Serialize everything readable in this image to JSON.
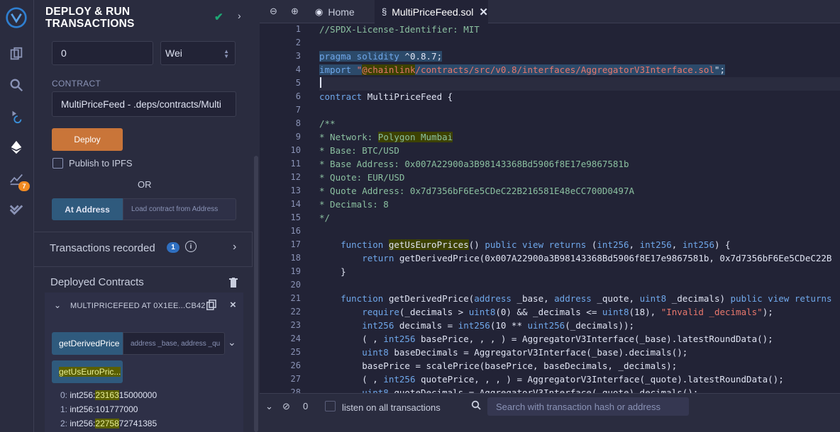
{
  "sidebar": {
    "badge_count": "7"
  },
  "panel": {
    "title": "DEPLOY & RUN TRANSACTIONS",
    "value": "0",
    "unit": "Wei",
    "contract_label": "CONTRACT",
    "contract_selected": "MultiPriceFeed - .deps/contracts/Multi",
    "deploy_label": "Deploy",
    "publish_label": "Publish to IPFS",
    "or_label": "OR",
    "at_address_label": "At Address",
    "at_address_placeholder": "Load contract from Address",
    "transactions_recorded": "Transactions recorded",
    "transactions_count": "1",
    "deployed_contracts": "Deployed Contracts",
    "instance_title": "MULTIPRICEFEED AT 0X1EE...CB42",
    "fn_derived": "getDerivedPrice",
    "fn_derived_placeholder": "address _base, address _qu",
    "fn_us_euro": "getUsEuroPric...",
    "outputs": [
      {
        "index": "0:",
        "type": "int256:",
        "hl": "23163",
        "rest": "15000000"
      },
      {
        "index": "1:",
        "type": "int256:",
        "hl": "",
        "rest": "101777000"
      },
      {
        "index": "2:",
        "type": "int256:",
        "hl": "22758",
        "rest": "72741385"
      }
    ]
  },
  "tabs": {
    "home": "Home",
    "file": "MultiPriceFeed.sol"
  },
  "editor": {
    "line_numbers": [
      "1",
      "2",
      "3",
      "4",
      "5",
      "6",
      "7",
      "8",
      "9",
      "10",
      "11",
      "12",
      "13",
      "14",
      "15",
      "16",
      "17",
      "18",
      "19",
      "20",
      "21",
      "22",
      "23",
      "24",
      "25",
      "26",
      "27",
      "28"
    ],
    "l1": "//SPDX-License-Identifier: MIT",
    "l3a": "pragma solidity",
    "l3b": " ^0.8.7;",
    "l4a": "import",
    "l4b": " \"",
    "l4c": "@chainlink",
    "l4d": "/contracts/src/v0.8/interfaces/AggregatorV3Interface.sol",
    "l4e": "\";",
    "l6a": "contract",
    "l6b": " MultiPriceFeed {",
    "l8": "/**",
    "l9a": "* Network: ",
    "l9b": "Polygon Mumbai",
    "l10": "* Base: BTC/USD",
    "l11": "* Base Address: 0x007A22900a3B98143368Bd5906f8E17e9867581b",
    "l12": "* Quote: EUR/USD",
    "l13": "* Quote Address: 0x7d7356bF6Ee5CDeC22B216581E48eCC700D0497A",
    "l14": "* Decimals: 8",
    "l15": "*/",
    "l17a": "    function ",
    "l17b": "getUsEuroPrices",
    "l17c": "() ",
    "l17d": "public view returns",
    "l17e": " (",
    "l17f": "int256",
    "l17g": ", ",
    "l17h": "int256",
    "l17i": ", ",
    "l17j": "int256",
    "l17k": ") {",
    "l18a": "        return",
    "l18b": " getDerivedPrice(0x007A22900a3B98143368Bd5906f8E17e9867581b, 0x7d7356bF6Ee5CDeC22B",
    "l19": "    }",
    "l21a": "    function",
    "l21b": " getDerivedPrice(",
    "l21c": "address",
    "l21d": " _base, ",
    "l21e": "address",
    "l21f": " _quote, ",
    "l21g": "uint8",
    "l21h": " _decimals) ",
    "l21i": "public view returns",
    "l22a": "        require",
    "l22b": "(_decimals > ",
    "l22c": "uint8",
    "l22d": "(0) && _decimals <= ",
    "l22e": "uint8",
    "l22f": "(18), ",
    "l22g": "\"Invalid _decimals\"",
    "l22h": ");",
    "l23a": "        int256",
    "l23b": " decimals = ",
    "l23c": "int256",
    "l23d": "(10 ** ",
    "l23e": "uint256",
    "l23f": "(_decimals));",
    "l24a": "        ( , ",
    "l24b": "int256",
    "l24c": " basePrice, , , ) = AggregatorV3Interface(_base).latestRoundData();",
    "l25a": "        uint8",
    "l25b": " baseDecimals = AggregatorV3Interface(_base).decimals();",
    "l26": "        basePrice = scalePrice(basePrice, baseDecimals, _decimals);",
    "l27a": "        ( , ",
    "l27b": "int256",
    "l27c": " quotePrice, , , ) = AggregatorV3Interface(_quote).latestRoundData();",
    "l28a": "        uint8",
    "l28b": " quoteDecimals = AggregatorV3Interface(_quote).decimals();"
  },
  "terminal": {
    "count": "0",
    "listen_label": "listen on all transactions",
    "search_placeholder": "Search with transaction hash or address"
  }
}
